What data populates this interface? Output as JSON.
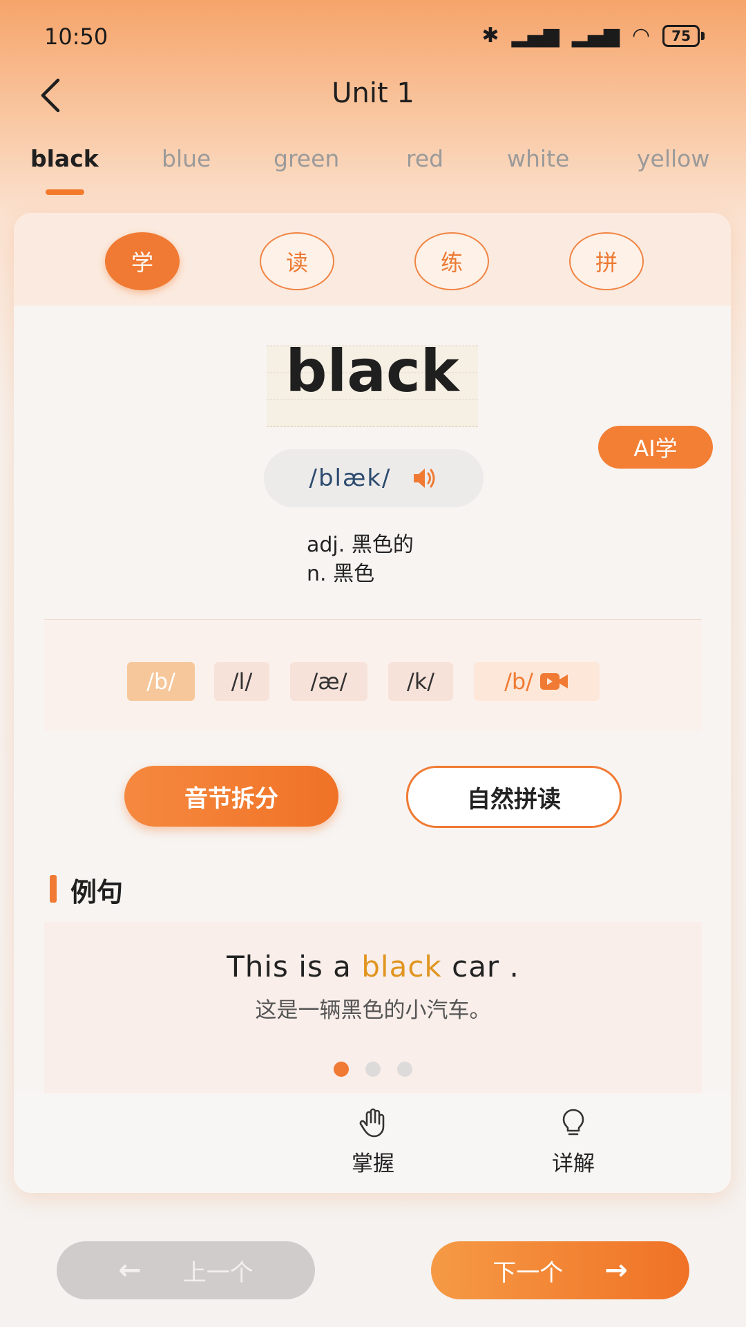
{
  "status_bar": {
    "time": "10:50",
    "battery": "75"
  },
  "header": {
    "title": "Unit 1"
  },
  "tabs": [
    {
      "label": "black",
      "active": true
    },
    {
      "label": "blue"
    },
    {
      "label": "green"
    },
    {
      "label": "red"
    },
    {
      "label": "white"
    },
    {
      "label": "yellow"
    }
  ],
  "modes": [
    {
      "label": "学",
      "active": true
    },
    {
      "label": "读"
    },
    {
      "label": "练"
    },
    {
      "label": "拼"
    }
  ],
  "word": {
    "text": "black",
    "phonetic": "/blæk/",
    "meanings": [
      "adj. 黑色的",
      "n. 黑色"
    ]
  },
  "ai_button": "AI学",
  "syllables": [
    "/b/",
    "/l/",
    "/æ/",
    "/k/",
    "/b/"
  ],
  "actions": {
    "split": "音节拆分",
    "phonics": "自然拼读"
  },
  "examples": {
    "title": "例句",
    "en_before": "This is a ",
    "en_highlight": "black",
    "en_after": " car .",
    "zh": "这是一辆黑色的小汽车。",
    "page_count": 3,
    "current_page": 1
  },
  "bottom_actions": [
    {
      "label": "掌握",
      "icon": "hand-icon"
    },
    {
      "label": "详解",
      "icon": "lightbulb-icon"
    }
  ],
  "navigation": {
    "prev": "上一个",
    "next": "下一个"
  },
  "colors": {
    "accent": "#f07a33",
    "highlight_word": "#e0951f"
  }
}
